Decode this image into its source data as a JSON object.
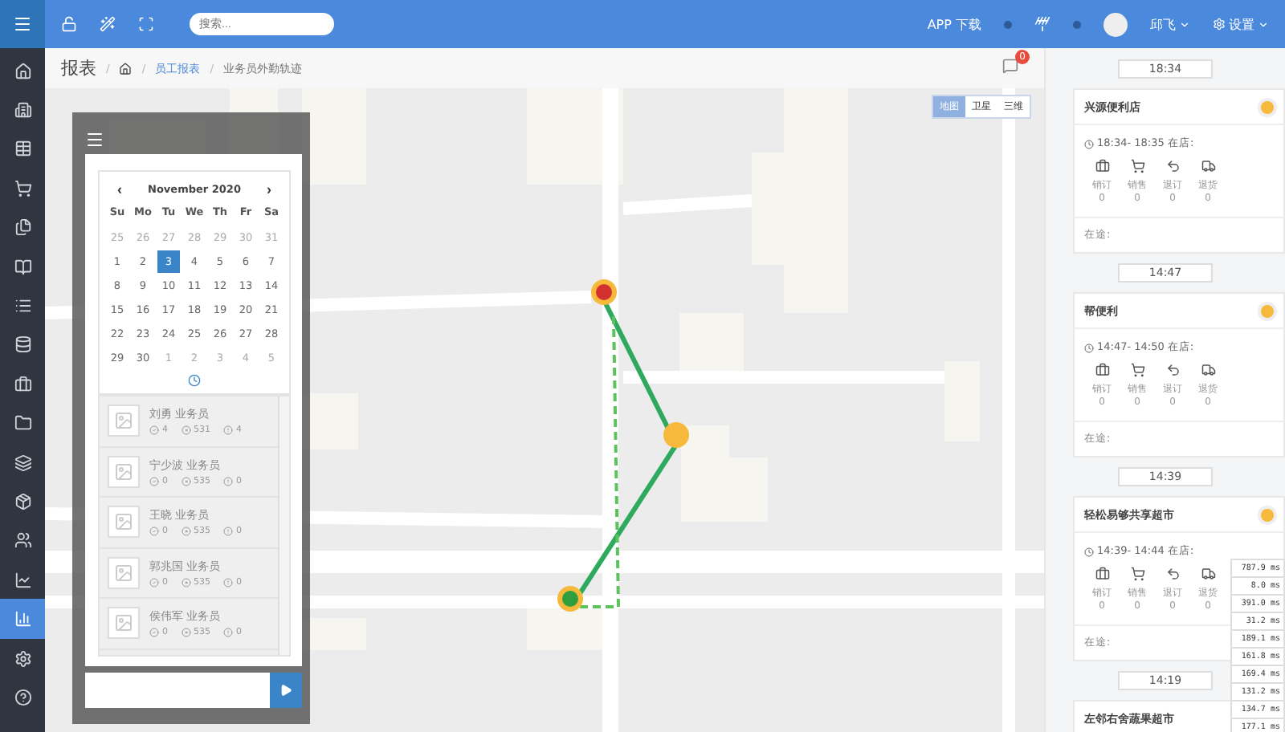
{
  "topbar": {
    "search": {
      "placeholder": "搜索..."
    },
    "app_download": "APP 下载",
    "user": "邱飞",
    "settings": "设置"
  },
  "sidebar": {
    "items": [
      {
        "selected": false
      },
      {
        "selected": false
      },
      {
        "selected": false
      },
      {
        "selected": false
      },
      {
        "selected": false
      },
      {
        "selected": false
      },
      {
        "selected": false
      },
      {
        "selected": false
      },
      {
        "selected": false
      },
      {
        "selected": false
      },
      {
        "selected": false
      },
      {
        "selected": false
      },
      {
        "selected": false
      },
      {
        "selected": false
      },
      {
        "selected": true
      },
      {
        "selected": false
      },
      {
        "selected": false
      }
    ]
  },
  "header": {
    "title": "报表",
    "separator": "/",
    "breadcrumb": [
      {
        "label": "员工报表",
        "kind": "link"
      },
      {
        "label": "业务员外勤轨迹",
        "kind": "current"
      }
    ],
    "notification_count": "0"
  },
  "map": {
    "types": [
      {
        "label": "地图",
        "selected": true
      },
      {
        "label": "卫星",
        "selected": false
      },
      {
        "label": "三维",
        "selected": false
      }
    ]
  },
  "panel": {
    "calendar": {
      "month": "November 2020",
      "prev": "‹",
      "next": "›",
      "weekdays": [
        "Su",
        "Mo",
        "Tu",
        "We",
        "Th",
        "Fr",
        "Sa"
      ],
      "weeks": [
        [
          {
            "day": "25",
            "other_month": true,
            "selected": false
          },
          {
            "day": "26",
            "other_month": true,
            "selected": false
          },
          {
            "day": "27",
            "other_month": true,
            "selected": false
          },
          {
            "day": "28",
            "other_month": true,
            "selected": false
          },
          {
            "day": "29",
            "other_month": true,
            "selected": false
          },
          {
            "day": "30",
            "other_month": true,
            "selected": false
          },
          {
            "day": "31",
            "other_month": true,
            "selected": false
          }
        ],
        [
          {
            "day": "1",
            "other_month": false,
            "selected": false
          },
          {
            "day": "2",
            "other_month": false,
            "selected": false
          },
          {
            "day": "3",
            "other_month": false,
            "selected": true
          },
          {
            "day": "4",
            "other_month": false,
            "selected": false
          },
          {
            "day": "5",
            "other_month": false,
            "selected": false
          },
          {
            "day": "6",
            "other_month": false,
            "selected": false
          },
          {
            "day": "7",
            "other_month": false,
            "selected": false
          }
        ],
        [
          {
            "day": "8",
            "other_month": false,
            "selected": false
          },
          {
            "day": "9",
            "other_month": false,
            "selected": false
          },
          {
            "day": "10",
            "other_month": false,
            "selected": false
          },
          {
            "day": "11",
            "other_month": false,
            "selected": false
          },
          {
            "day": "12",
            "other_month": false,
            "selected": false
          },
          {
            "day": "13",
            "other_month": false,
            "selected": false
          },
          {
            "day": "14",
            "other_month": false,
            "selected": false
          }
        ],
        [
          {
            "day": "15",
            "other_month": false,
            "selected": false
          },
          {
            "day": "16",
            "other_month": false,
            "selected": false
          },
          {
            "day": "17",
            "other_month": false,
            "selected": false
          },
          {
            "day": "18",
            "other_month": false,
            "selected": false
          },
          {
            "day": "19",
            "other_month": false,
            "selected": false
          },
          {
            "day": "20",
            "other_month": false,
            "selected": false
          },
          {
            "day": "21",
            "other_month": false,
            "selected": false
          }
        ],
        [
          {
            "day": "22",
            "other_month": false,
            "selected": false
          },
          {
            "day": "23",
            "other_month": false,
            "selected": false
          },
          {
            "day": "24",
            "other_month": false,
            "selected": false
          },
          {
            "day": "25",
            "other_month": false,
            "selected": false
          },
          {
            "day": "26",
            "other_month": false,
            "selected": false
          },
          {
            "day": "27",
            "other_month": false,
            "selected": false
          },
          {
            "day": "28",
            "other_month": false,
            "selected": false
          }
        ],
        [
          {
            "day": "29",
            "other_month": false,
            "selected": false
          },
          {
            "day": "30",
            "other_month": false,
            "selected": false
          },
          {
            "day": "1",
            "other_month": true,
            "selected": false
          },
          {
            "day": "2",
            "other_month": true,
            "selected": false
          },
          {
            "day": "3",
            "other_month": true,
            "selected": false
          },
          {
            "day": "4",
            "other_month": true,
            "selected": false
          },
          {
            "day": "5",
            "other_month": true,
            "selected": false
          }
        ]
      ]
    },
    "staff": [
      {
        "name": "刘勇",
        "role": "业务员",
        "done": "4",
        "visits": "531",
        "alerts": "4"
      },
      {
        "name": "宁少波",
        "role": "业务员",
        "done": "0",
        "visits": "535",
        "alerts": "0"
      },
      {
        "name": "王晓",
        "role": "业务员",
        "done": "0",
        "visits": "535",
        "alerts": "0"
      },
      {
        "name": "郭兆国",
        "role": "业务员",
        "done": "0",
        "visits": "535",
        "alerts": "0"
      },
      {
        "name": "侯伟军",
        "role": "业务员",
        "done": "0",
        "visits": "535",
        "alerts": "0"
      }
    ]
  },
  "timeline": [
    {
      "time": "18:34",
      "store": "兴源便利店",
      "period": "18:34- 18:35 在店:",
      "stats": [
        {
          "label": "销订",
          "value": "0"
        },
        {
          "label": "销售",
          "value": "0"
        },
        {
          "label": "退订",
          "value": "0"
        },
        {
          "label": "退货",
          "value": "0"
        }
      ],
      "transit": "在途:"
    },
    {
      "time": "14:47",
      "store": "帮便利",
      "period": "14:47- 14:50 在店:",
      "stats": [
        {
          "label": "销订",
          "value": "0"
        },
        {
          "label": "销售",
          "value": "0"
        },
        {
          "label": "退订",
          "value": "0"
        },
        {
          "label": "退货",
          "value": "0"
        }
      ],
      "transit": "在途:"
    },
    {
      "time": "14:39",
      "store": "轻松易够共享超市",
      "period": "14:39- 14:44 在店:",
      "stats": [
        {
          "label": "销订",
          "value": "0"
        },
        {
          "label": "销售",
          "value": "0"
        },
        {
          "label": "退订",
          "value": "0"
        },
        {
          "label": "退货",
          "value": "0"
        }
      ],
      "transit": "在途:"
    },
    {
      "time": "14:19",
      "store": "左邻右舍蔬果超市"
    }
  ],
  "latency": [
    {
      "value": "787.9",
      "unit": "ms"
    },
    {
      "value": "8.0",
      "unit": "ms"
    },
    {
      "value": "391.0",
      "unit": "ms"
    },
    {
      "value": "31.2",
      "unit": "ms"
    },
    {
      "value": "189.1",
      "unit": "ms"
    },
    {
      "value": "161.8",
      "unit": "ms"
    },
    {
      "value": "169.4",
      "unit": "ms"
    },
    {
      "value": "131.2",
      "unit": "ms"
    },
    {
      "value": "134.7",
      "unit": "ms"
    },
    {
      "value": "177.1",
      "unit": "ms"
    }
  ]
}
